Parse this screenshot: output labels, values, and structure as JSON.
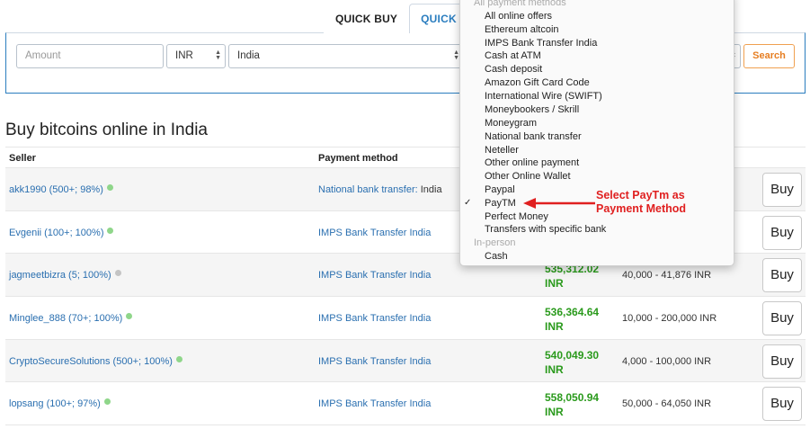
{
  "tabs": [
    {
      "label": "QUICK BUY"
    },
    {
      "label": "QUICK S"
    }
  ],
  "search": {
    "amount_placeholder": "Amount",
    "currency": "INR",
    "country": "India",
    "search_label": "Search"
  },
  "page_title": "Buy bitcoins online in India",
  "table": {
    "headers": {
      "seller": "Seller",
      "method": "Payment method"
    },
    "rows": [
      {
        "seller": "akk1990 (500+; 98%)",
        "status": "online",
        "method": "National bank transfer:",
        "method_extra": " India",
        "price_line1": "",
        "price_line2": "",
        "limits": "",
        "buy": "Buy"
      },
      {
        "seller": "Evgenii (100+; 100%)",
        "status": "online",
        "method": "IMPS Bank Transfer India",
        "method_extra": "",
        "price_line1": "",
        "price_line2": "",
        "limits": "",
        "buy": "Buy"
      },
      {
        "seller": "jagmeetbizra (5; 100%)",
        "status": "offline",
        "method": "IMPS Bank Transfer India",
        "method_extra": "",
        "price_line1": "535,312.02",
        "price_line2": "INR",
        "limits": "40,000 - 41,876 INR",
        "buy": "Buy"
      },
      {
        "seller": "Minglee_888 (70+; 100%)",
        "status": "online",
        "method": "IMPS Bank Transfer India",
        "method_extra": "",
        "price_line1": "536,364.64",
        "price_line2": "INR",
        "limits": "10,000 - 200,000 INR",
        "buy": "Buy"
      },
      {
        "seller": "CryptoSecureSolutions (500+; 100%)",
        "status": "online",
        "method": "IMPS Bank Transfer India",
        "method_extra": "",
        "price_line1": "540,049.30",
        "price_line2": "INR",
        "limits": "4,000 - 100,000 INR",
        "buy": "Buy"
      },
      {
        "seller": "lopsang (100+; 97%)",
        "status": "online",
        "method": "IMPS Bank Transfer India",
        "method_extra": "",
        "price_line1": "558,050.94",
        "price_line2": "INR",
        "limits": "50,000 - 64,050 INR",
        "buy": "Buy"
      }
    ]
  },
  "dropdown": {
    "items": [
      {
        "label": "All payment methods",
        "group": true
      },
      {
        "label": "All online offers"
      },
      {
        "label": "Ethereum altcoin"
      },
      {
        "label": "IMPS Bank Transfer India"
      },
      {
        "label": "Cash at ATM"
      },
      {
        "label": "Cash deposit"
      },
      {
        "label": "Amazon Gift Card Code"
      },
      {
        "label": "International Wire (SWIFT)"
      },
      {
        "label": "Moneybookers / Skrill"
      },
      {
        "label": "Moneygram"
      },
      {
        "label": "National bank transfer"
      },
      {
        "label": "Neteller"
      },
      {
        "label": "Other online payment"
      },
      {
        "label": "Other Online Wallet"
      },
      {
        "label": "Paypal"
      },
      {
        "label": "PayTM",
        "selected": true
      },
      {
        "label": "Perfect Money"
      },
      {
        "label": "Transfers with specific bank"
      },
      {
        "label": "In-person",
        "group": true
      },
      {
        "label": "Cash"
      }
    ]
  },
  "annotation": {
    "line1": "Select PayTm as",
    "line2": "Payment Method"
  },
  "colors": {
    "link": "#2a6fb0",
    "price": "#2a9a1c",
    "online": "#8fd68a",
    "offline": "#c4c4c4",
    "annotation": "#e02020",
    "search": "#e67e22"
  }
}
